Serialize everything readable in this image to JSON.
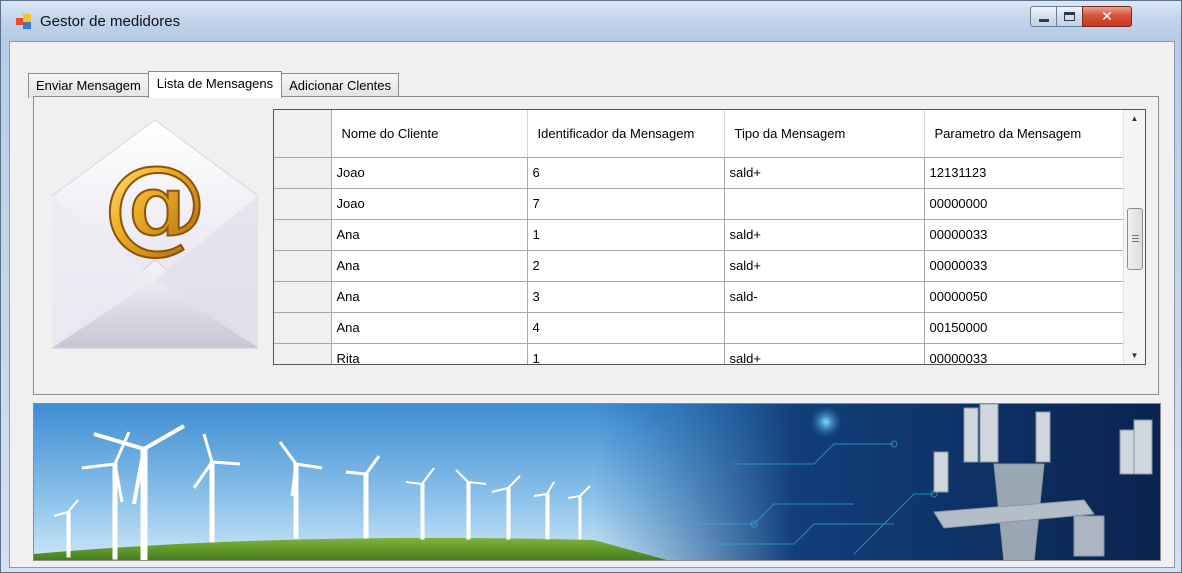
{
  "window": {
    "title": "Gestor de medidores",
    "controls": {
      "minimize": "minimize-icon",
      "maximize": "maximize-icon",
      "close": "close-icon"
    }
  },
  "tabs": [
    {
      "label": "Enviar Mensagem",
      "active": false
    },
    {
      "label": "Lista de Mensagens",
      "active": true
    },
    {
      "label": "Adicionar Clentes",
      "active": false
    }
  ],
  "grid": {
    "columns": [
      "Nome do Cliente",
      "Identificador da Mensagem",
      "Tipo da Mensagem",
      "Parametro da Mensagem"
    ],
    "rows": [
      [
        "Joao",
        "6",
        "sald+",
        "12131123"
      ],
      [
        "Joao",
        "7",
        "",
        "00000000"
      ],
      [
        "Ana",
        "1",
        "sald+",
        "00000033"
      ],
      [
        "Ana",
        "2",
        "sald+",
        "00000033"
      ],
      [
        "Ana",
        "3",
        "sald-",
        "00000050"
      ],
      [
        "Ana",
        "4",
        "",
        "00150000"
      ],
      [
        "Rita",
        "1",
        "sald+",
        "00000033"
      ]
    ]
  },
  "icons": {
    "envelope": "email-envelope-icon",
    "scroll_up": "scroll-up-arrow-icon",
    "scroll_down": "scroll-down-arrow-icon"
  },
  "colors": {
    "accent_gold": "#e0a020",
    "title_bar": "#c2d5ec",
    "close_red": "#c23a1f",
    "banner_sky": "#5ea3d8",
    "banner_tech": "#0b2a5a"
  }
}
